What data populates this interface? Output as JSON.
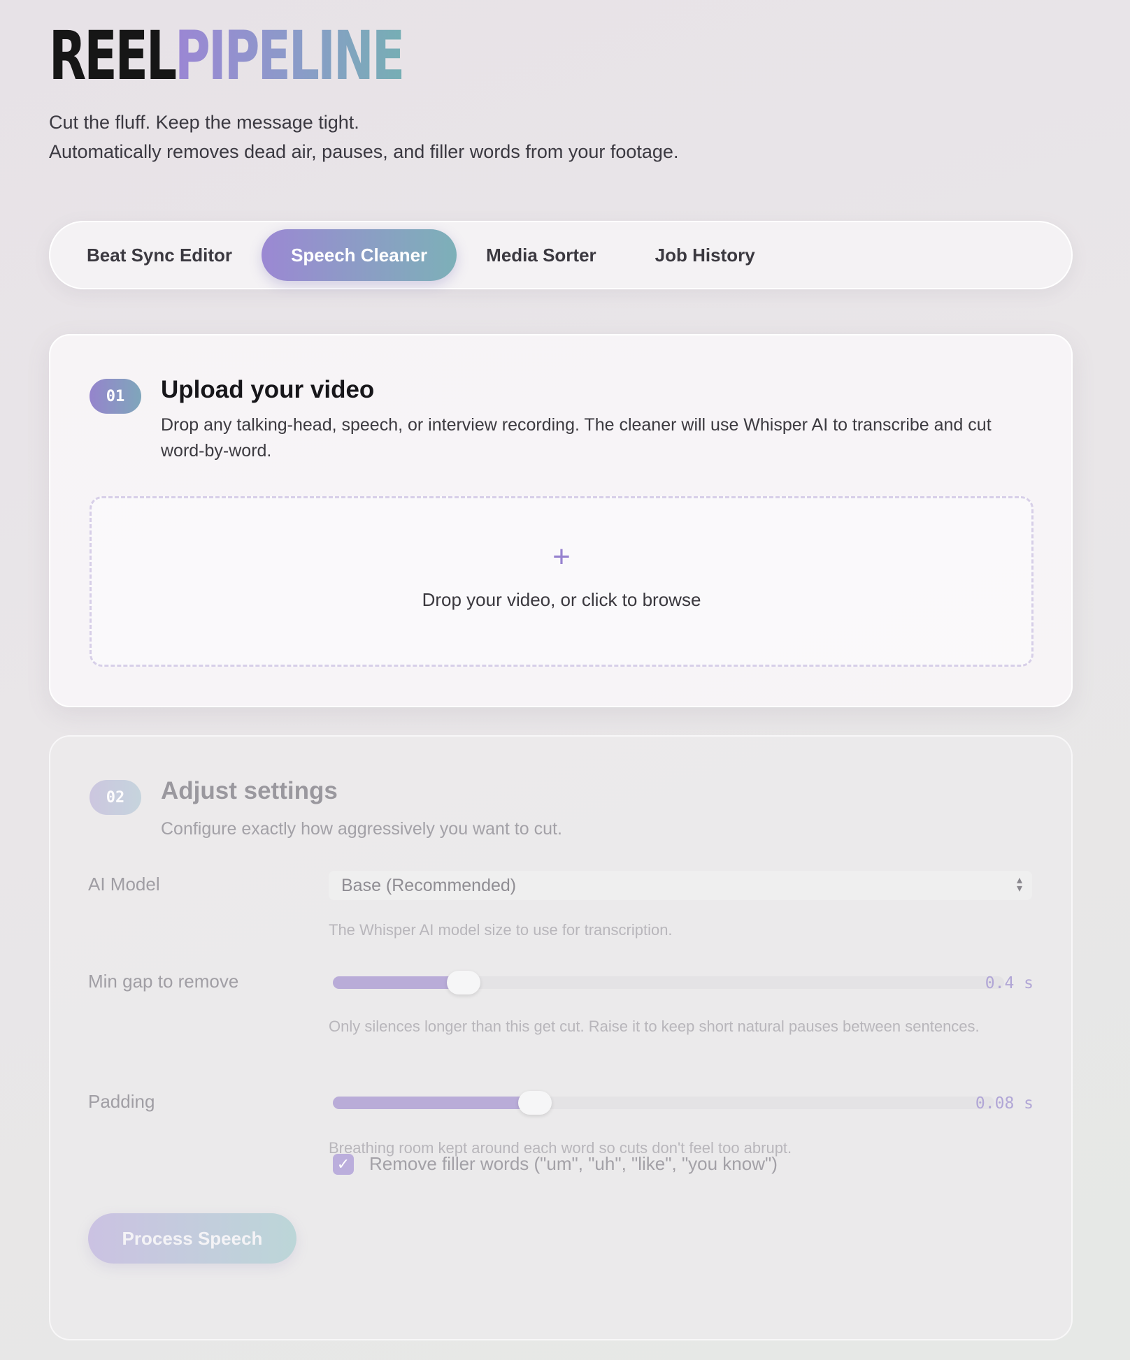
{
  "brand": {
    "part1": "REEL",
    "part2": "PIPELINE"
  },
  "tagline": {
    "line1": "Cut the fluff. Keep the message tight.",
    "line2": "Automatically removes dead air, pauses, and filler words from your footage."
  },
  "tabs": [
    {
      "label": "Beat Sync Editor",
      "active": false
    },
    {
      "label": "Speech Cleaner",
      "active": true
    },
    {
      "label": "Media Sorter",
      "active": false
    },
    {
      "label": "Job History",
      "active": false
    }
  ],
  "upload": {
    "step": "01",
    "title": "Upload your video",
    "description": "Drop any talking-head, speech, or interview recording. The cleaner will use Whisper AI to transcribe and cut word-by-word.",
    "drop_icon": "+",
    "drop_text": "Drop your video, or click to browse"
  },
  "settings": {
    "step": "02",
    "title": "Adjust settings",
    "description": "Configure exactly how aggressively you want to cut.",
    "model": {
      "label": "AI Model",
      "value": "Base (Recommended)",
      "hint": "The Whisper AI model size to use for transcription."
    },
    "min_gap": {
      "label": "Min gap to remove",
      "value_text": "0.4 s",
      "fraction": 0.17,
      "hint": "Only silences longer than this get cut. Raise it to keep short natural pauses between sentences."
    },
    "padding": {
      "label": "Padding",
      "value_text": "0.08 s",
      "fraction": 0.28,
      "hint": "Breathing room kept around each word so cuts don't feel too abrupt."
    },
    "filler": {
      "checked": true,
      "label": "Remove filler words (\"um\", \"uh\", \"like\", \"you know\")"
    },
    "process_label": "Process Speech"
  },
  "colors": {
    "accent_start": "#9b88d3",
    "accent_end": "#7db0b8"
  }
}
